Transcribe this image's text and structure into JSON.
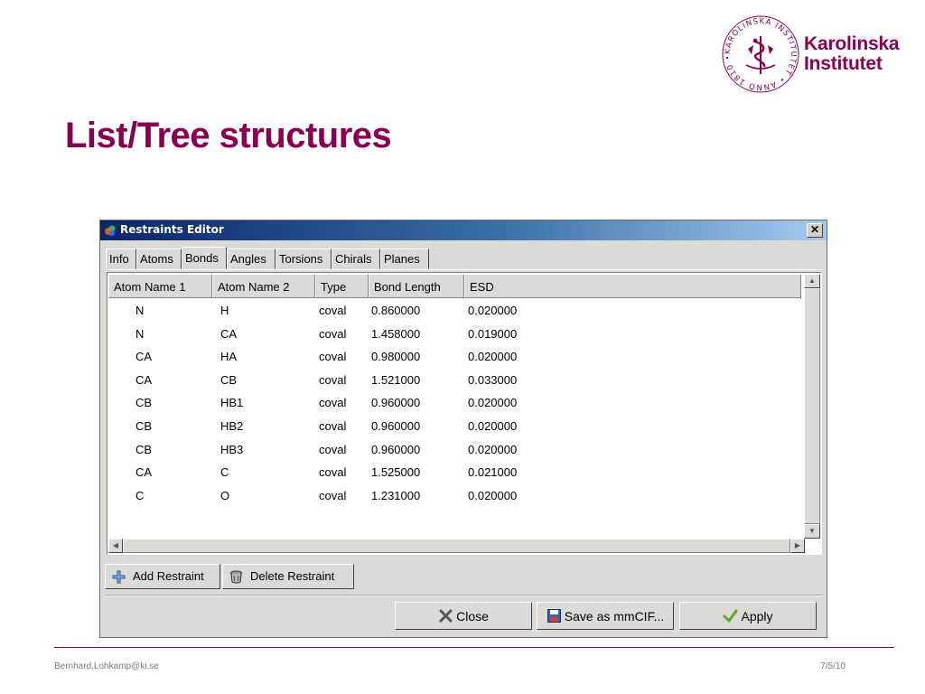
{
  "slide": {
    "title": "List/Tree structures",
    "footer_left": "Bernhard.Lohkamp@ki.se",
    "footer_right": "7/5/10"
  },
  "logo": {
    "name_line1": "Karolinska",
    "name_line2": "Institutet",
    "seal_text": "KAROLINSKA INSTITUTET • ANNO 1810 •",
    "brand_color": "#870052"
  },
  "dialog": {
    "title": "Restraints Editor",
    "close_glyph": "✕",
    "tabs": [
      {
        "label": "Info",
        "active": false
      },
      {
        "label": "Atoms",
        "active": false
      },
      {
        "label": "Bonds",
        "active": true
      },
      {
        "label": "Angles",
        "active": false
      },
      {
        "label": "Torsions",
        "active": false
      },
      {
        "label": "Chirals",
        "active": false
      },
      {
        "label": "Planes",
        "active": false
      }
    ],
    "table": {
      "columns": [
        "Atom Name 1",
        "Atom Name 2",
        "Type",
        "Bond Length",
        "ESD"
      ],
      "rows": [
        [
          "N",
          "H",
          "coval",
          "0.860000",
          "0.020000"
        ],
        [
          "N",
          "CA",
          "coval",
          "1.458000",
          "0.019000"
        ],
        [
          "CA",
          "HA",
          "coval",
          "0.980000",
          "0.020000"
        ],
        [
          "CA",
          "CB",
          "coval",
          "1.521000",
          "0.033000"
        ],
        [
          "CB",
          "HB1",
          "coval",
          "0.960000",
          "0.020000"
        ],
        [
          "CB",
          "HB2",
          "coval",
          "0.960000",
          "0.020000"
        ],
        [
          "CB",
          "HB3",
          "coval",
          "0.960000",
          "0.020000"
        ],
        [
          "CA",
          "C",
          "coval",
          "1.525000",
          "0.021000"
        ],
        [
          "C",
          "O",
          "coval",
          "1.231000",
          "0.020000"
        ]
      ]
    },
    "add_restraint_label": "Add Restraint",
    "delete_restraint_label": "Delete Restraint",
    "close_label": "Close",
    "save_label": "Save as mmCIF...",
    "apply_label": "Apply",
    "icons": {
      "add": "plus-icon",
      "delete": "trash-can-icon",
      "close": "x-icon",
      "save": "floppy-disk-icon",
      "apply": "checkmark-icon"
    }
  }
}
